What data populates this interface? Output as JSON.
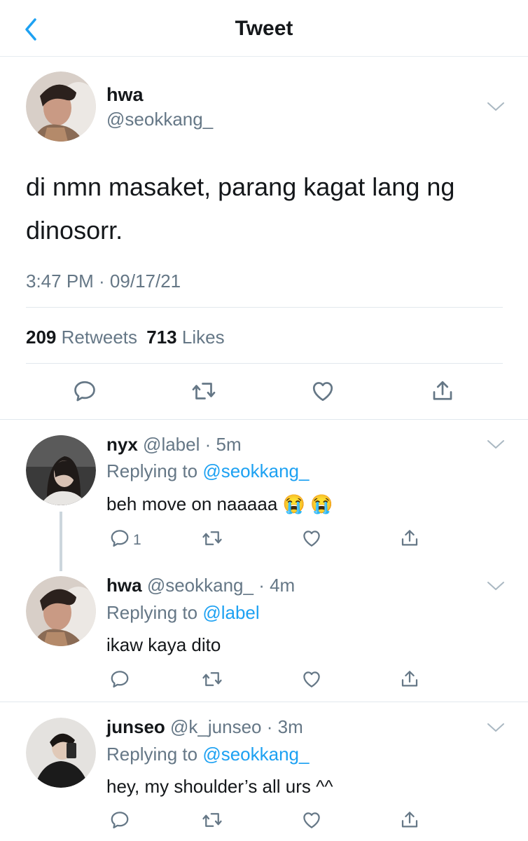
{
  "header": {
    "title": "Tweet"
  },
  "main_tweet": {
    "display_name": "hwa",
    "handle": "@seokkang_",
    "text_line1": "di nmn masaket, parang kagat lang ng",
    "text_line2": "dinosorr.",
    "timestamp": "3:47 PM · 09/17/21",
    "retweets_count": "209",
    "retweets_label": "Retweets",
    "likes_count": "713",
    "likes_label": "Likes"
  },
  "replies": [
    {
      "display_name": "nyx",
      "handle": "@label",
      "time": "· 5m",
      "replying_prefix": "Replying to",
      "replying_to": "@seokkang_",
      "text": "beh move on naaaaa",
      "emoji": "😭 😭",
      "reply_count": "1"
    },
    {
      "display_name": "hwa",
      "handle": "@seokkang_",
      "time": "· 4m",
      "replying_prefix": "Replying to",
      "replying_to": "@label",
      "text": "ikaw kaya dito"
    },
    {
      "display_name": "junseo",
      "handle": "@k_junseo",
      "time": "· 3m",
      "replying_prefix": "Replying to",
      "replying_to": "@seokkang_",
      "text": "hey, my shoulder’s all urs ^^"
    }
  ],
  "colors": {
    "accent": "#1da1f2",
    "muted": "#657786",
    "text": "#14171a",
    "divider": "#e1e8ed"
  },
  "icons": [
    "back-chevron-icon",
    "chevron-down-icon",
    "reply-icon",
    "retweet-icon",
    "like-icon",
    "share-icon"
  ]
}
